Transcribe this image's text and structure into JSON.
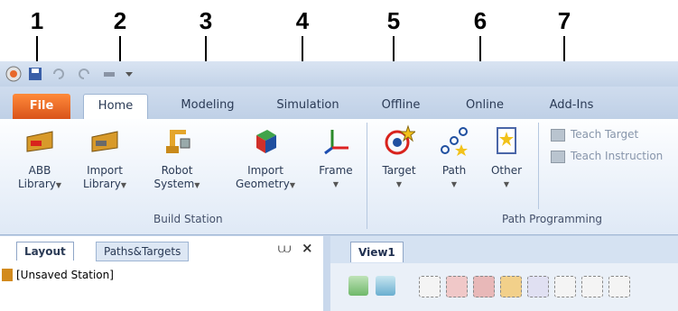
{
  "annotations": [
    "1",
    "2",
    "3",
    "4",
    "5",
    "6",
    "7"
  ],
  "tabs": {
    "file": "File",
    "home": "Home",
    "modeling": "Modeling",
    "simulation": "Simulation",
    "offline": "Offline",
    "online": "Online",
    "addins": "Add-Ins"
  },
  "ribbon": {
    "abb_library": [
      "ABB",
      "Library"
    ],
    "import_library": [
      "Import",
      "Library"
    ],
    "robot_system": [
      "Robot",
      "System"
    ],
    "import_geometry": [
      "Import",
      "Geometry"
    ],
    "frame": "Frame",
    "target": "Target",
    "path": "Path",
    "other": "Other",
    "teach_target": "Teach Target",
    "teach_instruction": "Teach Instruction",
    "group_build_station": "Build Station",
    "group_path_programming": "Path Programming"
  },
  "panels": {
    "layout_tab": "Layout",
    "paths_targets_tab": "Paths&Targets",
    "pin_glyph": "⩊",
    "close_glyph": "×",
    "station_item": "[Unsaved Station]",
    "view_tab": "View1"
  },
  "colors": {
    "file_tab": "#e8682a",
    "ribbon_bg": "#dfe9f6",
    "tab_bar": "#c3d3e8"
  }
}
